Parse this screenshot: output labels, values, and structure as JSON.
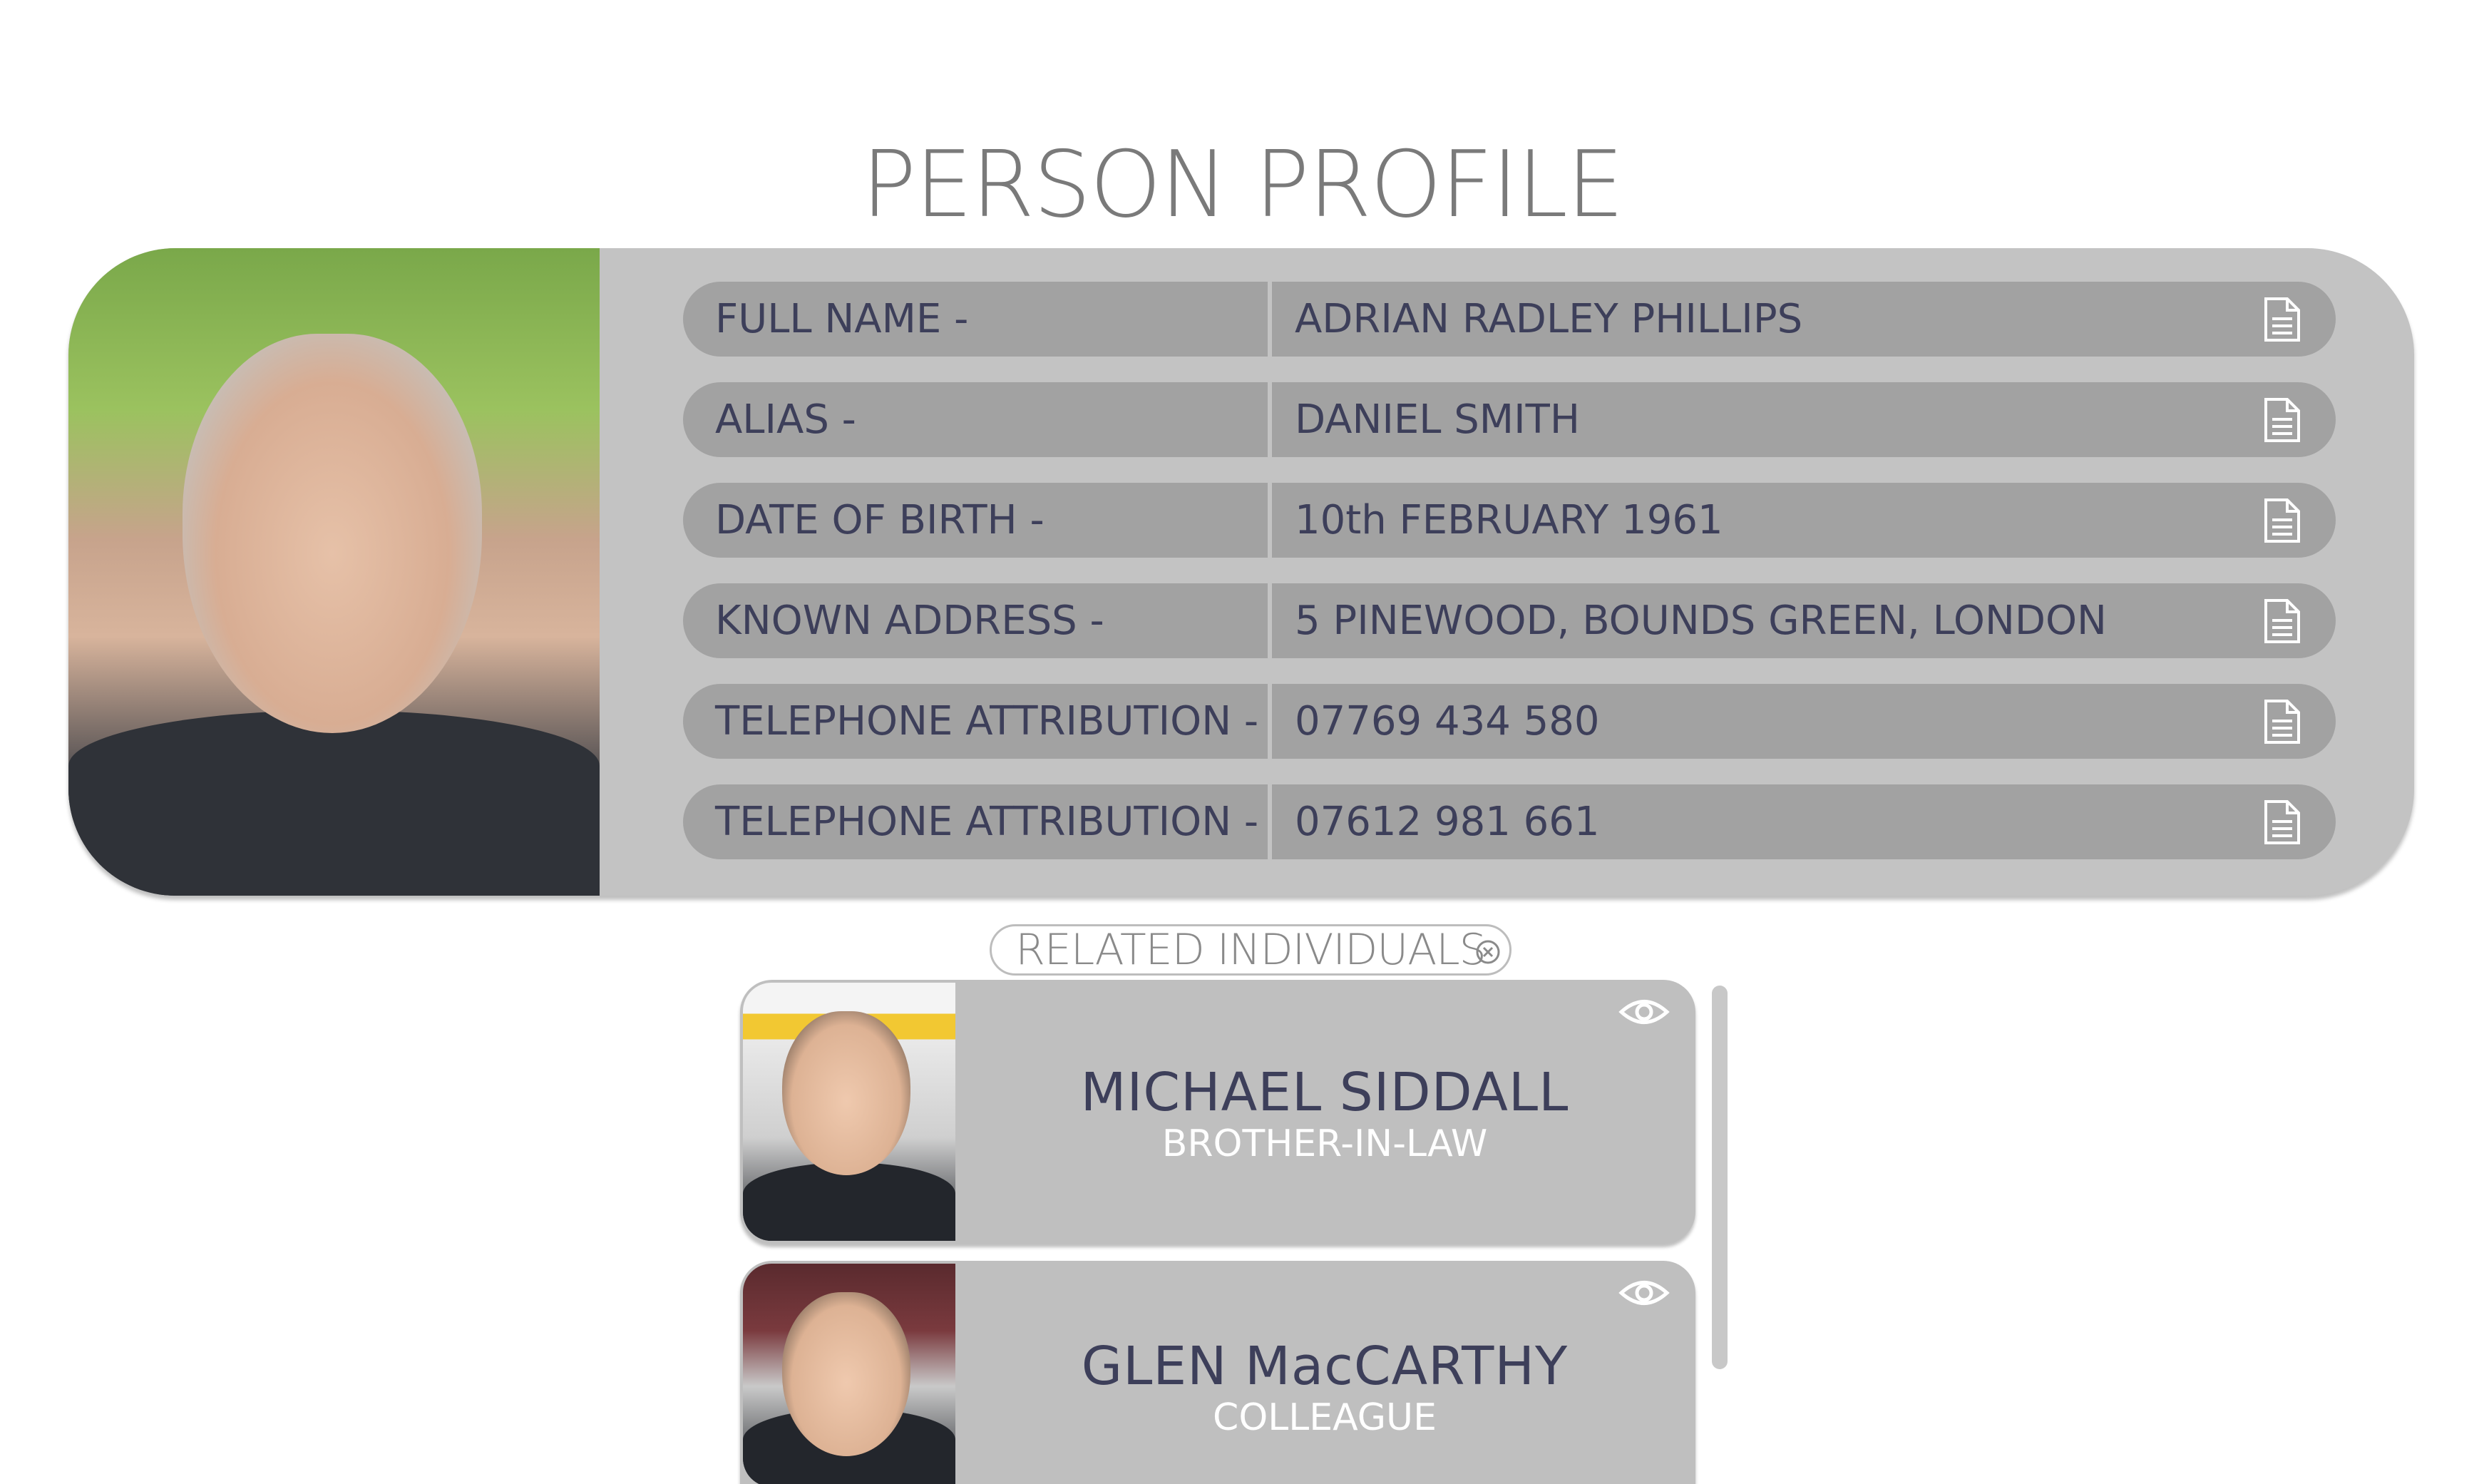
{
  "title": "PERSON PROFILE",
  "profile": {
    "fields": [
      {
        "label": "FULL NAME -",
        "value": "ADRIAN RADLEY PHILLIPS",
        "icon": "document-icon"
      },
      {
        "label": "ALIAS -",
        "value": "DANIEL SMITH",
        "icon": "document-icon"
      },
      {
        "label": "DATE OF BIRTH -",
        "value": "10th FEBRUARY 1961",
        "icon": "document-icon"
      },
      {
        "label": "KNOWN ADDRESS -",
        "value": "5 PINEWOOD, BOUNDS GREEN, LONDON",
        "icon": "document-icon"
      },
      {
        "label": "TELEPHONE ATTRIBUTION -",
        "value": "07769 434 580",
        "icon": "document-icon"
      },
      {
        "label": "TELEPHONE ATTRIBUTION -",
        "value": "07612 981 661",
        "icon": "document-icon"
      }
    ]
  },
  "related": {
    "heading": "RELATED INDIVIDUALS",
    "close_icon": "close-circle-icon",
    "people": [
      {
        "name": "MICHAEL SIDDALL",
        "relation": "BROTHER-IN-LAW",
        "icon": "eye-icon"
      },
      {
        "name": "GLEN MacCARTHY",
        "relation": "COLLEAGUE",
        "icon": "eye-icon"
      }
    ]
  },
  "colors": {
    "panel": "#c3c3c3",
    "row": "#a2a2a2",
    "text": "#3d3f5a",
    "card": "#bfbfbf"
  }
}
